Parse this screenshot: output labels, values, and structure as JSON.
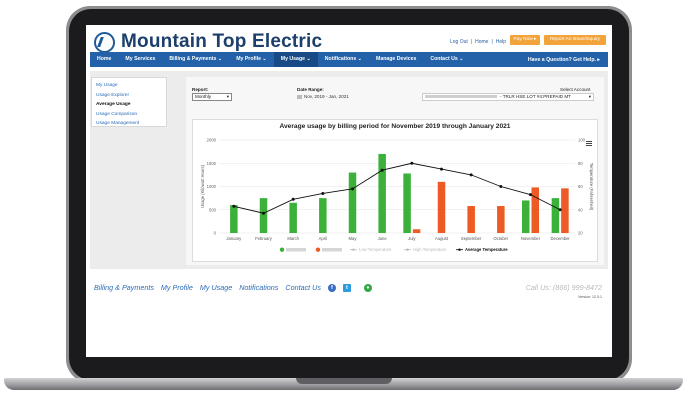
{
  "header": {
    "logo_text": "Mountain Top Electric",
    "top_links": [
      "Log Out",
      "|",
      "Home",
      "|",
      "Help"
    ],
    "pay_now": "Pay Now ▸",
    "report_outage": "Report An Issue/Inquiry"
  },
  "nav": {
    "items": [
      {
        "label": "Home"
      },
      {
        "label": "My Services"
      },
      {
        "label": "Billing & Payments ⌄"
      },
      {
        "label": "My Profile ⌄"
      },
      {
        "label": "My Usage ⌄"
      },
      {
        "label": "Notifications ⌄"
      },
      {
        "label": "Manage Devices"
      },
      {
        "label": "Contact Us ⌄"
      }
    ],
    "help": "Have a Question? Get Help. ▸"
  },
  "sidebar": {
    "items": [
      "My Usage",
      "Usage Explorer",
      "Average Usage",
      "Usage Comparison",
      "Usage Management"
    ]
  },
  "controls": {
    "report_label": "Report:",
    "report_value": "Monthly",
    "date_label": "Date Range:",
    "date_value": "Nov, 2019 - Jan, 2021",
    "account_label": "Select Account",
    "account_value": "- TRLR HSE LOT #4:PREPAID MT"
  },
  "chart_data": {
    "type": "bar",
    "title": "Average usage by billing period for November 2019 through January 2021",
    "categories": [
      "January",
      "February",
      "March",
      "April",
      "May",
      "June",
      "July",
      "August",
      "September",
      "October",
      "November",
      "December"
    ],
    "ylabel": "Usage (Kilowatt Hours)",
    "y2label": "Temperature (Fahrenheit)",
    "ylim": [
      0,
      2000
    ],
    "y2lim": [
      20,
      100
    ],
    "yticks": [
      "0",
      "500",
      "1000",
      "1500",
      "2000"
    ],
    "y2ticks": [
      "20",
      "40",
      "60",
      "80",
      "100"
    ],
    "series": [
      {
        "color": "#3cb13a",
        "values": [
          600,
          750,
          650,
          750,
          1300,
          1700,
          1280,
          null,
          null,
          null,
          700,
          750
        ]
      },
      {
        "color": "#ee5a24",
        "values": [
          null,
          null,
          null,
          null,
          null,
          null,
          80,
          1100,
          580,
          580,
          980,
          960
        ]
      },
      {
        "name": "Average Temperature",
        "color": "#111111",
        "values": [
          43,
          37,
          49,
          54,
          58,
          74,
          80,
          75,
          70,
          60,
          53,
          40
        ]
      }
    ],
    "legend": [
      "Low Temperature",
      "High Temperature",
      "Average Temperature"
    ],
    "grid": true,
    "legend_position": "bottom"
  },
  "footer": {
    "links": [
      "Billing & Payments",
      "My Profile",
      "My Usage",
      "Notifications",
      "Contact Us"
    ],
    "phone": "Call Us: (866) 999-8472",
    "version": "Version: 12.5.1"
  }
}
